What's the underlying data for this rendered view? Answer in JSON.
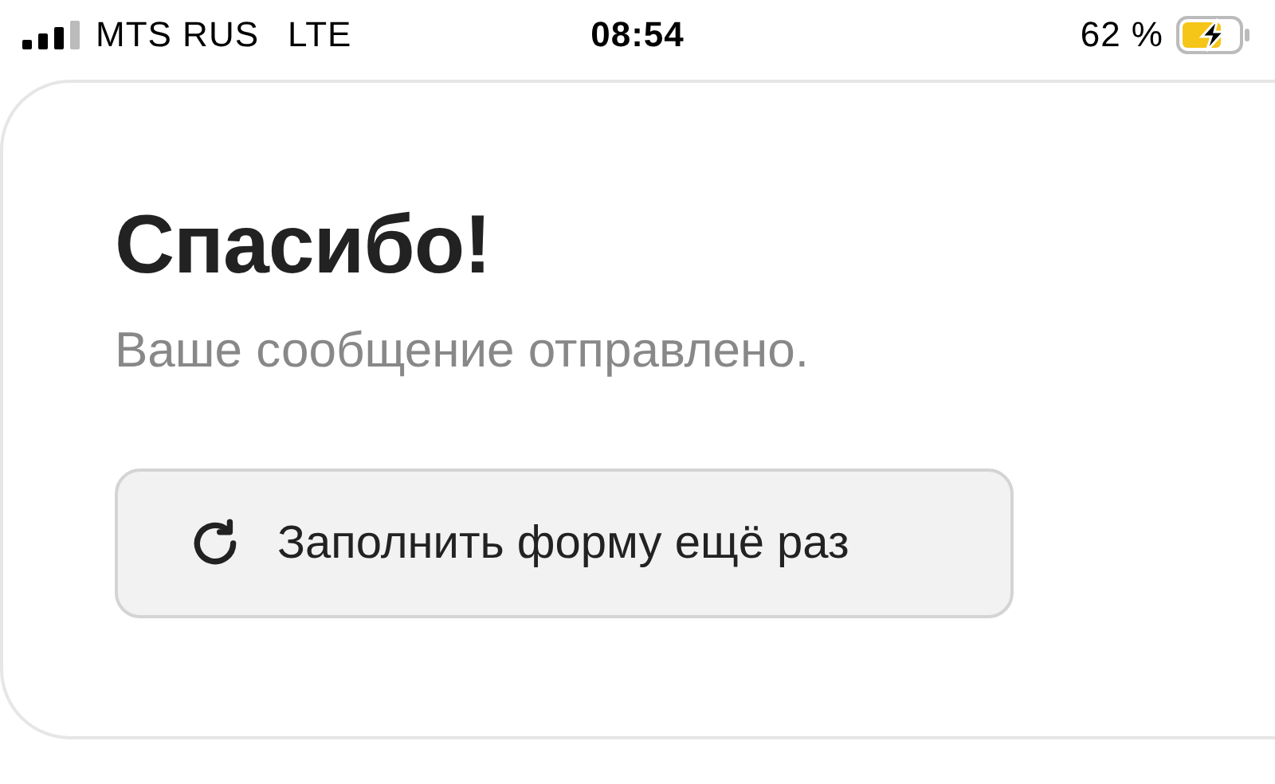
{
  "status_bar": {
    "carrier": "MTS RUS",
    "network": "LTE",
    "time": "08:54",
    "battery": "62 %",
    "charging": true
  },
  "card": {
    "title": "Спасибо!",
    "message": "Ваше сообщение отправлено.",
    "button": "Заполнить форму ещё раз"
  }
}
